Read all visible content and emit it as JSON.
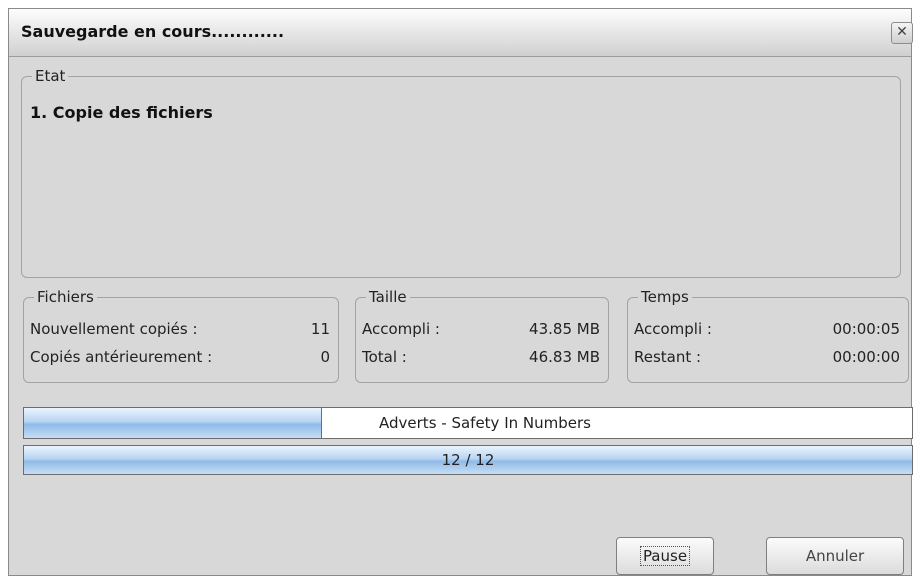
{
  "window": {
    "title": "Sauvegarde en cours............",
    "close_glyph": "✕"
  },
  "etat": {
    "legend": "Etat",
    "status": "1. Copie des fichiers"
  },
  "fichiers": {
    "legend": "Fichiers",
    "rows": [
      {
        "label": "Nouvellement copiés :",
        "value": "11"
      },
      {
        "label": "Copiés antérieurement :",
        "value": "0"
      }
    ]
  },
  "taille": {
    "legend": "Taille",
    "rows": [
      {
        "label": "Accompli :",
        "value": "43.85 MB"
      },
      {
        "label": "Total :",
        "value": "46.83 MB"
      }
    ]
  },
  "temps": {
    "legend": "Temps",
    "rows": [
      {
        "label": "Accompli :",
        "value": "00:00:05"
      },
      {
        "label": "Restant :",
        "value": "00:00:00"
      }
    ]
  },
  "progress": {
    "file": {
      "label": "Adverts - Safety In Numbers",
      "fraction": 0.335
    },
    "total": {
      "label": "12 / 12",
      "fraction": 1.0
    }
  },
  "buttons": {
    "pause": "Pause",
    "cancel": "Annuler"
  }
}
